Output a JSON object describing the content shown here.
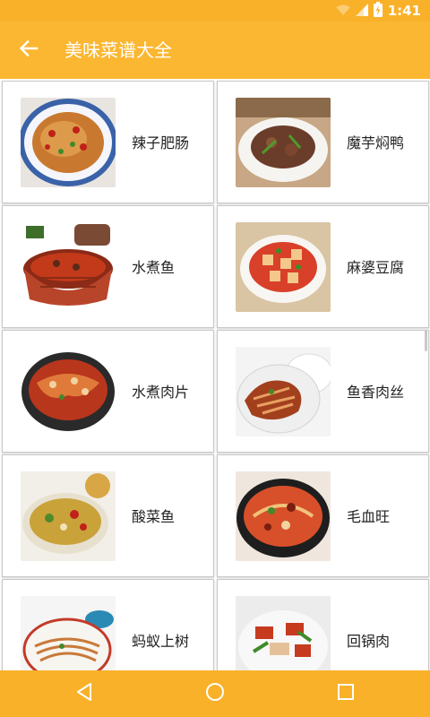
{
  "status_bar": {
    "time": "1:41",
    "icons": [
      "wifi-icon",
      "signal-icon",
      "battery-icon"
    ]
  },
  "app_bar": {
    "title": "美味菜谱大全",
    "back_icon": "arrow-left-icon"
  },
  "dishes": [
    {
      "name": "辣子肥肠"
    },
    {
      "name": "魔芋焖鸭"
    },
    {
      "name": "水煮鱼"
    },
    {
      "name": "麻婆豆腐"
    },
    {
      "name": "水煮肉片"
    },
    {
      "name": "鱼香肉丝"
    },
    {
      "name": "酸菜鱼"
    },
    {
      "name": "毛血旺"
    },
    {
      "name": "蚂蚁上树"
    },
    {
      "name": "回锅肉"
    }
  ],
  "nav_bar": {
    "icons": [
      "back-triangle-icon",
      "home-circle-icon",
      "recents-square-icon"
    ]
  },
  "colors": {
    "accent": "#fbb731",
    "status": "#f9b12a"
  }
}
